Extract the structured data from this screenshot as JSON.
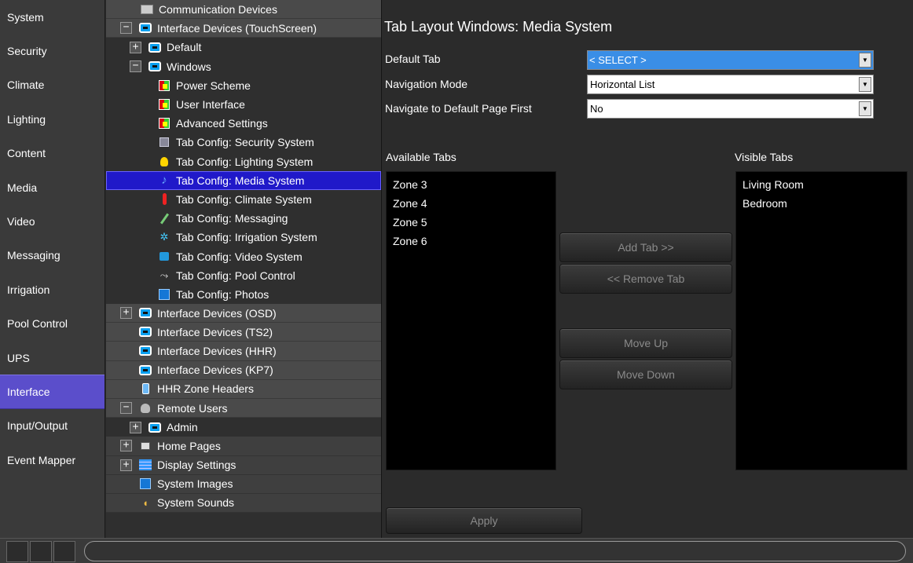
{
  "nav": {
    "items": [
      {
        "label": "System"
      },
      {
        "label": "Security"
      },
      {
        "label": "Climate"
      },
      {
        "label": "Lighting"
      },
      {
        "label": "Content"
      },
      {
        "label": "Media"
      },
      {
        "label": "Video"
      },
      {
        "label": "Messaging"
      },
      {
        "label": "Irrigation"
      },
      {
        "label": "Pool Control"
      },
      {
        "label": "UPS"
      },
      {
        "label": "Interface"
      },
      {
        "label": "Input/Output"
      },
      {
        "label": "Event Mapper"
      }
    ],
    "active": "Interface"
  },
  "tree": {
    "items": [
      {
        "label": "Communication Devices",
        "icon": "communication-icon"
      },
      {
        "label": "Interface Devices (TouchScreen)",
        "icon": "touchscreen-icon"
      },
      {
        "label": "Default",
        "icon": "touchscreen-icon"
      },
      {
        "label": "Windows",
        "icon": "touchscreen-icon"
      },
      {
        "label": "Power Scheme",
        "icon": "settings-grid-icon"
      },
      {
        "label": "User Interface",
        "icon": "settings-grid-icon"
      },
      {
        "label": "Advanced Settings",
        "icon": "settings-grid-icon"
      },
      {
        "label": "Tab Config: Security System",
        "icon": "security-icon"
      },
      {
        "label": "Tab Config: Lighting System",
        "icon": "bulb-icon"
      },
      {
        "label": "Tab Config: Media System",
        "icon": "music-note-icon"
      },
      {
        "label": "Tab Config: Climate System",
        "icon": "thermometer-icon"
      },
      {
        "label": "Tab Config: Messaging",
        "icon": "pen-icon"
      },
      {
        "label": "Tab Config: Irrigation System",
        "icon": "sprinkler-icon"
      },
      {
        "label": "Tab Config: Video System",
        "icon": "tv-icon"
      },
      {
        "label": "Tab Config: Pool Control",
        "icon": "pool-icon"
      },
      {
        "label": "Tab Config: Photos",
        "icon": "photo-icon"
      },
      {
        "label": "Interface Devices (OSD)",
        "icon": "touchscreen-icon"
      },
      {
        "label": "Interface Devices (TS2)",
        "icon": "touchscreen-icon"
      },
      {
        "label": "Interface Devices (HHR)",
        "icon": "touchscreen-icon"
      },
      {
        "label": "Interface Devices (KP7)",
        "icon": "touchscreen-icon"
      },
      {
        "label": "HHR Zone Headers",
        "icon": "handheld-icon"
      },
      {
        "label": "Remote Users",
        "icon": "user-icon"
      },
      {
        "label": "Admin",
        "icon": "touchscreen-icon"
      },
      {
        "label": "Home Pages",
        "icon": "home-page-icon"
      },
      {
        "label": "Display Settings",
        "icon": "display-icon"
      },
      {
        "label": "System Images",
        "icon": "photo-icon"
      },
      {
        "label": "System Sounds",
        "icon": "speaker-icon"
      }
    ],
    "selected": "Tab Config: Media System"
  },
  "main": {
    "title": "Tab Layout Windows: Media System",
    "default_tab_label": "Default Tab",
    "default_tab_value": "< SELECT >",
    "nav_mode_label": "Navigation Mode",
    "nav_mode_value": "Horizontal List",
    "nav_default_label": "Navigate to Default Page First",
    "nav_default_value": "No",
    "available_label": "Available Tabs",
    "visible_label": "Visible Tabs",
    "available_tabs": [
      "Zone 3",
      "Zone 4",
      "Zone 5",
      "Zone 6"
    ],
    "visible_tabs": [
      "Living Room",
      "Bedroom"
    ],
    "add_tab": "Add Tab >>",
    "remove_tab": "<< Remove Tab",
    "move_up": "Move Up",
    "move_down": "Move Down",
    "apply": "Apply"
  },
  "colors": {
    "active_nav": "#5b4ecb",
    "tree_selected": "#2019c9",
    "select_highlight": "#3a8ee6"
  }
}
